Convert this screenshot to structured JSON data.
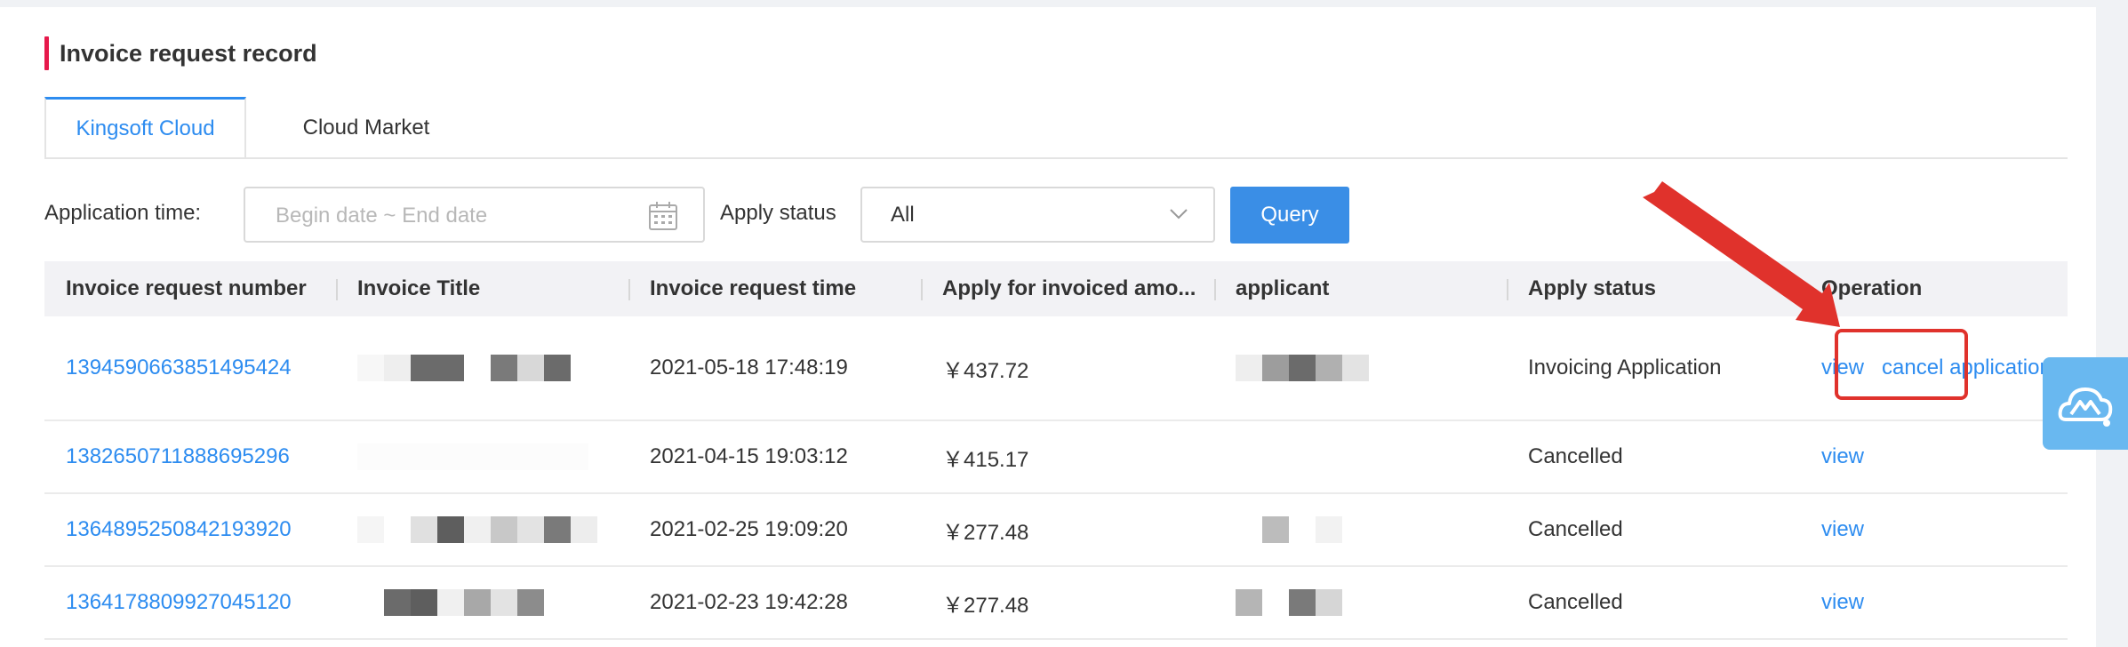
{
  "section": {
    "title": "Invoice request record"
  },
  "tabs": [
    {
      "label": "Kingsoft Cloud",
      "active": true
    },
    {
      "label": "Cloud Market",
      "active": false
    }
  ],
  "filters": {
    "time_label": "Application time:",
    "date_placeholder": "Begin date ~ End date",
    "status_label": "Apply status",
    "status_value": "All",
    "query_label": "Query"
  },
  "table": {
    "columns": [
      "Invoice request number",
      "Invoice Title",
      "Invoice request time",
      "Apply for invoiced amo...",
      "applicant",
      "Apply status",
      "Operation"
    ],
    "rows": [
      {
        "number": "1394590663851495424",
        "time": "2021-05-18 17:48:19",
        "amount": "￥437.72",
        "status": "Invoicing Application",
        "op_view": "view",
        "op_cancel": "cancel application"
      },
      {
        "number": "1382650711888695296",
        "time": "2021-04-15 19:03:12",
        "amount": "￥415.17",
        "status": "Cancelled",
        "op_view": "view",
        "op_cancel": ""
      },
      {
        "number": "1364895250842193920",
        "time": "2021-02-25 19:09:20",
        "amount": "￥277.48",
        "status": "Cancelled",
        "op_view": "view",
        "op_cancel": ""
      },
      {
        "number": "1364178809927045120",
        "time": "2021-02-23 19:42:28",
        "amount": "￥277.48",
        "status": "Cancelled",
        "op_view": "view",
        "op_cancel": ""
      }
    ]
  },
  "colors": {
    "accent": "#2d8cf0",
    "title_bar": "#e6194b",
    "query_button": "#3a8ee6",
    "status_pending": "#f0962a",
    "annotation": "#e0322c",
    "widget": "#69b8f0"
  },
  "icons": {
    "calendar": "calendar-icon",
    "dropdown": "chevron-down-icon",
    "widget": "cloud-chat-icon"
  }
}
